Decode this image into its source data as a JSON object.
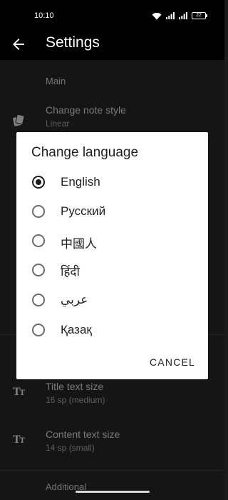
{
  "status_bar": {
    "time": "10:10",
    "battery": "22"
  },
  "app_bar": {
    "title": "Settings",
    "back_icon": "arrow-back-icon"
  },
  "settings": {
    "sections": [
      {
        "header": "Main",
        "prefs": [
          {
            "title": "Change note style",
            "summary": "Linear",
            "icon": "cards-icon"
          }
        ]
      },
      {
        "header": "",
        "prefs": [
          {
            "title": "Title text size",
            "summary": "16 sp (medium)",
            "icon": "text-size-icon"
          },
          {
            "title": "Content text size",
            "summary": "14 sp (small)",
            "icon": "text-size-icon"
          }
        ]
      },
      {
        "header": "Additional",
        "prefs": []
      }
    ]
  },
  "dialog": {
    "title": "Change language",
    "selected": "English",
    "options": [
      "English",
      "Русский",
      "中國人",
      "हिंदी",
      "عربي",
      "Қазақ"
    ],
    "cancel_label": "CANCEL"
  },
  "colors": {
    "background": "#2a2a2a",
    "dialog": "#ffffff",
    "status_bar": "#000000"
  }
}
